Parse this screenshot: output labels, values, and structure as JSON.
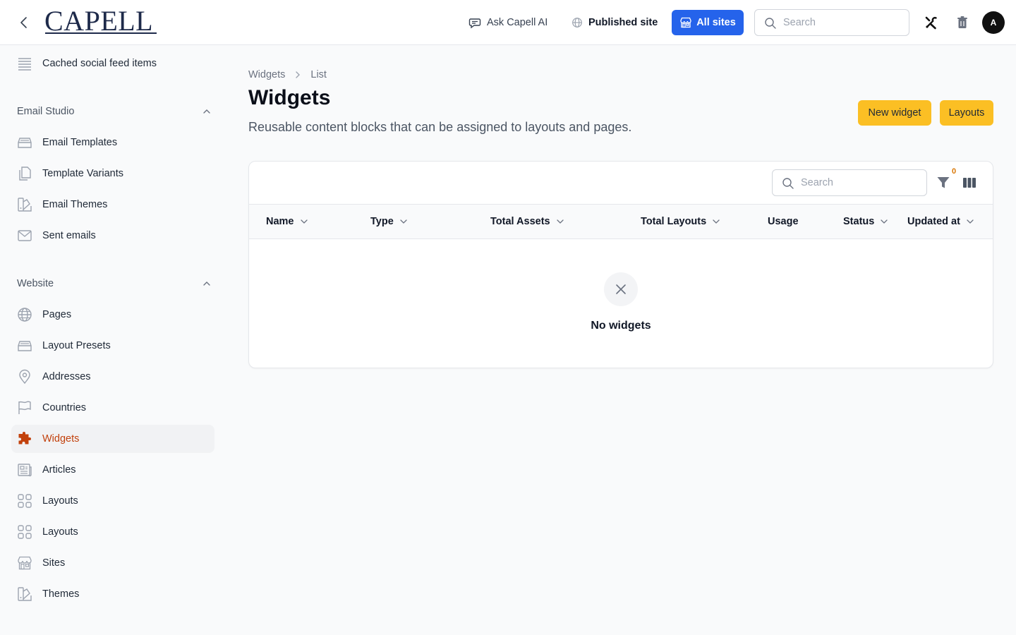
{
  "header": {
    "logo_text": "CAPELL",
    "ask_ai_label": "Ask Capell AI",
    "published_site_label": "Published site",
    "all_sites_label": "All sites",
    "search_placeholder": "Search",
    "avatar_initial": "A"
  },
  "sidebar": {
    "top_item": {
      "label": "Cached social feed items",
      "icon": "list-icon"
    },
    "groups": [
      {
        "title": "Email Studio",
        "expanded": true,
        "items": [
          {
            "label": "Email Templates",
            "icon": "tray-icon"
          },
          {
            "label": "Template Variants",
            "icon": "copy-icon"
          },
          {
            "label": "Email Themes",
            "icon": "swatch-icon"
          },
          {
            "label": "Sent emails",
            "icon": "envelope-icon"
          }
        ]
      },
      {
        "title": "Website",
        "expanded": true,
        "items": [
          {
            "label": "Pages",
            "icon": "globe-icon"
          },
          {
            "label": "Layout Presets",
            "icon": "tray-icon"
          },
          {
            "label": "Addresses",
            "icon": "map-pin-icon"
          },
          {
            "label": "Countries",
            "icon": "flag-icon"
          },
          {
            "label": "Widgets",
            "icon": "puzzle-icon",
            "active": true
          },
          {
            "label": "Articles",
            "icon": "newspaper-icon"
          },
          {
            "label": "Layouts",
            "icon": "squares-icon"
          },
          {
            "label": "Layouts",
            "icon": "squares-icon"
          },
          {
            "label": "Sites",
            "icon": "storefront-icon"
          },
          {
            "label": "Themes",
            "icon": "swatch-icon"
          }
        ]
      }
    ]
  },
  "main": {
    "breadcrumb": [
      "Widgets",
      "List"
    ],
    "title": "Widgets",
    "subtitle": "Reusable content blocks that can be assigned to layouts and pages.",
    "actions": {
      "new_widget": "New widget",
      "layouts": "Layouts"
    },
    "table": {
      "search_placeholder": "Search",
      "filter_count": "0",
      "columns": [
        {
          "label": "Name",
          "sortable": true
        },
        {
          "label": "Type",
          "sortable": true
        },
        {
          "label": "Total Assets",
          "sortable": true
        },
        {
          "label": "Total Layouts",
          "sortable": true
        },
        {
          "label": "Usage",
          "sortable": false
        },
        {
          "label": "Status",
          "sortable": true
        },
        {
          "label": "Updated at",
          "sortable": true
        }
      ],
      "rows": [],
      "empty_message": "No widgets"
    }
  },
  "colors": {
    "primary": "#2563eb",
    "accent_amber": "#fbbf24",
    "active_nav_text": "#c2410c",
    "badge": "#d97706"
  }
}
